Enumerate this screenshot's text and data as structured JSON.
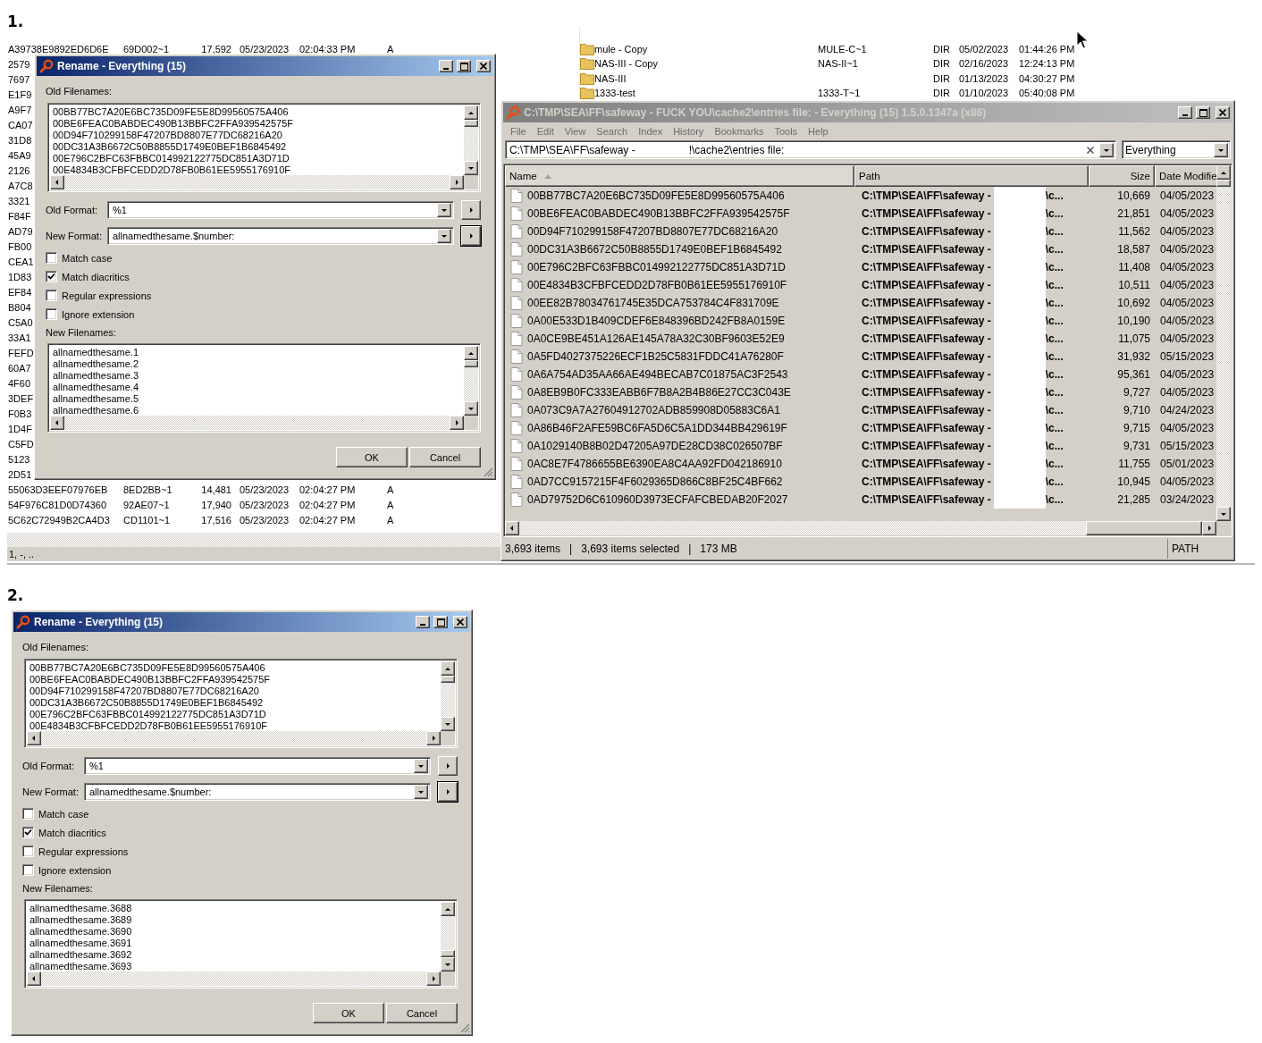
{
  "screenshot_1": {
    "label": "1.",
    "background_list": {
      "rows": [
        {
          "kind": "row",
          "name": "A39738E9892ED6D6E",
          "short_name": "69D002~1",
          "size": "17,592",
          "date": "05/23/2023",
          "time": "02:04:33 PM",
          "attributes": "A"
        },
        {
          "kind": "fragment",
          "name": "2579"
        },
        {
          "kind": "fragment",
          "name": "7697"
        },
        {
          "kind": "fragment",
          "name": "E1F9"
        },
        {
          "kind": "fragment",
          "name": "A9F7"
        },
        {
          "kind": "fragment",
          "name": "CA07"
        },
        {
          "kind": "fragment",
          "name": "31D8"
        },
        {
          "kind": "fragment",
          "name": "45A9"
        },
        {
          "kind": "fragment",
          "name": "2126"
        },
        {
          "kind": "fragment",
          "name": "A7C8"
        },
        {
          "kind": "fragment",
          "name": "3321"
        },
        {
          "kind": "fragment",
          "name": "F84F"
        },
        {
          "kind": "fragment",
          "name": "AD79"
        },
        {
          "kind": "fragment",
          "name": "FB00"
        },
        {
          "kind": "fragment",
          "name": "CEA1"
        },
        {
          "kind": "fragment",
          "name": "1D83"
        },
        {
          "kind": "fragment",
          "name": "EF84"
        },
        {
          "kind": "fragment",
          "name": "B804"
        },
        {
          "kind": "fragment",
          "name": "C5A0"
        },
        {
          "kind": "fragment",
          "name": "33A1"
        },
        {
          "kind": "fragment",
          "name": "FEFD"
        },
        {
          "kind": "fragment",
          "name": "60A7"
        },
        {
          "kind": "fragment",
          "name": "4F60"
        },
        {
          "kind": "fragment",
          "name": "3DEF"
        },
        {
          "kind": "fragment",
          "name": "F0B3"
        },
        {
          "kind": "fragment",
          "name": "1D4F"
        },
        {
          "kind": "fragment",
          "name": "C5FD"
        },
        {
          "kind": "fragment",
          "name": "5123"
        },
        {
          "kind": "fragment",
          "name": "2D51"
        },
        {
          "kind": "row",
          "name": "55063D3EEF07976EB",
          "short_name": "8ED2BB~1",
          "size": "14,481",
          "date": "05/23/2023",
          "time": "02:04:27 PM",
          "attributes": "A"
        },
        {
          "kind": "row",
          "name": "54F976C81D0D74360",
          "short_name": "92AE07~1",
          "size": "17,940",
          "date": "05/23/2023",
          "time": "02:04:27 PM",
          "attributes": "A"
        },
        {
          "kind": "row",
          "name": "5C62C72949B2CA4D3",
          "short_name": "CD1101~1",
          "size": "17,516",
          "date": "05/23/2023",
          "time": "02:04:27 PM",
          "attributes": "A"
        }
      ],
      "status_text": "1, -, .."
    },
    "folder_list": {
      "rows": [
        {
          "name": "mule - Copy",
          "short_name": "MULE-C~1",
          "type": "DIR",
          "date": "05/02/2023",
          "time": "01:44:26 PM"
        },
        {
          "name": "NAS-III - Copy",
          "short_name": "NAS-II~1",
          "type": "DIR",
          "date": "02/16/2023",
          "time": "12:24:13 PM"
        },
        {
          "name": "NAS-III",
          "type": "DIR",
          "date": "01/13/2023",
          "time": "04:30:27 PM"
        },
        {
          "name": "1333-test",
          "short_name": "1333-T~1",
          "type": "DIR",
          "date": "01/10/2023",
          "time": "05:40:08 PM"
        }
      ]
    },
    "rename_dialog": {
      "title": "Rename - Everything (15)",
      "old_filenames_label": "Old Filenames:",
      "old_filenames": [
        "00BB77BC7A20E6BC735D09FE5E8D99560575A406",
        "00BE6FEAC0BABDEC490B13BBFC2FFA939542575F",
        "00D94F710299158F47207BD8807E77DC68216A20",
        "00DC31A3B6672C50B8855D1749E0BEF1B6845492",
        "00E796C2BFC63FBBC014992122775DC851A3D71D",
        "00E4834B3CFBFCEDD2D78FB0B61EE5955176910F"
      ],
      "old_format_label": "Old Format:",
      "old_format": "%1",
      "new_format_label": "New Format:",
      "new_format": "allnamedthesame.$number:",
      "options": [
        {
          "label": "Match case",
          "checked": false
        },
        {
          "label": "Match diacritics",
          "checked": true
        },
        {
          "label": "Regular expressions",
          "checked": false
        },
        {
          "label": "Ignore extension",
          "checked": false
        }
      ],
      "new_filenames_label": "New Filenames:",
      "new_filenames": [
        "allnamedthesame.1",
        "allnamedthesame.2",
        "allnamedthesame.3",
        "allnamedthesame.4",
        "allnamedthesame.5",
        "allnamedthesame.6"
      ],
      "buttons": [
        "OK",
        "Cancel"
      ]
    },
    "everything_window": {
      "title": "C:\\TMP\\SEA\\FF\\safeway - FUCK YOU\\cache2\\entries file: - Everything (15) 1.5.0.1347a (x86)",
      "menu": [
        "File",
        "Edit",
        "View",
        "Search",
        "Index",
        "History",
        "Bookmarks",
        "Tools",
        "Help"
      ],
      "search": {
        "value_start": "C:\\TMP\\SEA\\FF\\safeway -",
        "value_end": "!\\cache2\\entries file:"
      },
      "filter": "Everything",
      "columns": [
        {
          "label": "Name",
          "sorted": true
        },
        {
          "label": "Path",
          "sorted": false
        },
        {
          "label": "Size",
          "sorted": false
        },
        {
          "label": "Date Modifie",
          "sorted": false
        }
      ],
      "rows": [
        {
          "name": "00BB77BC7A20E6BC735D09FE5E8D99560575A406",
          "path_start": "C:\\TMP\\SEA\\FF\\safeway -",
          "path_end": "\\c...",
          "size": "10,669",
          "date": "04/05/2023"
        },
        {
          "name": "00BE6FEAC0BABDEC490B13BBFC2FFA939542575F",
          "path_start": "C:\\TMP\\SEA\\FF\\safeway -",
          "path_end": "\\c...",
          "size": "21,851",
          "date": "04/05/2023"
        },
        {
          "name": "00D94F710299158F47207BD8807E77DC68216A20",
          "path_start": "C:\\TMP\\SEA\\FF\\safeway -",
          "path_end": "\\c...",
          "size": "11,562",
          "date": "04/05/2023"
        },
        {
          "name": "00DC31A3B6672C50B8855D1749E0BEF1B6845492",
          "path_start": "C:\\TMP\\SEA\\FF\\safeway -",
          "path_end": "\\c...",
          "size": "18,587",
          "date": "04/05/2023"
        },
        {
          "name": "00E796C2BFC63FBBC014992122775DC851A3D71D",
          "path_start": "C:\\TMP\\SEA\\FF\\safeway -",
          "path_end": "\\c...",
          "size": "11,408",
          "date": "04/05/2023"
        },
        {
          "name": "00E4834B3CFBFCEDD2D78FB0B61EE5955176910F",
          "path_start": "C:\\TMP\\SEA\\FF\\safeway -",
          "path_end": "\\c...",
          "size": "10,511",
          "date": "04/05/2023"
        },
        {
          "name": "00EE82B78034761745E35DCA753784C4F831709E",
          "path_start": "C:\\TMP\\SEA\\FF\\safeway -",
          "path_end": "\\c...",
          "size": "10,692",
          "date": "04/05/2023"
        },
        {
          "name": "0A00E533D1B409CDEF6E848396BD242FB8A0159E",
          "path_start": "C:\\TMP\\SEA\\FF\\safeway -",
          "path_end": "\\c...",
          "size": "10,190",
          "date": "04/05/2023"
        },
        {
          "name": "0A0CE9BE451A126AE145A78A32C30BF9603E52E9",
          "path_start": "C:\\TMP\\SEA\\FF\\safeway -",
          "path_end": "\\c...",
          "size": "11,075",
          "date": "04/05/2023"
        },
        {
          "name": "0A5FD4027375226ECF1B25C5831FDDC41A76280F",
          "path_start": "C:\\TMP\\SEA\\FF\\safeway -",
          "path_end": "\\c...",
          "size": "31,932",
          "date": "05/15/2023"
        },
        {
          "name": "0A6A754AD35AA66AE494BECAB7C01875AC3F2543",
          "path_start": "C:\\TMP\\SEA\\FF\\safeway -",
          "path_end": "\\c...",
          "size": "95,361",
          "date": "04/05/2023"
        },
        {
          "name": "0A8EB9B0FC333EABB6F7B8A2B4B86E27CC3C043E",
          "path_start": "C:\\TMP\\SEA\\FF\\safeway -",
          "path_end": "\\c...",
          "size": "9,727",
          "date": "04/05/2023"
        },
        {
          "name": "0A073C9A7A27604912702ADB859908D05883C6A1",
          "path_start": "C:\\TMP\\SEA\\FF\\safeway -",
          "path_end": "\\c...",
          "size": "9,710",
          "date": "04/24/2023"
        },
        {
          "name": "0A86B46F2AFE59BC6FA5D6C5A1DD344BB429619F",
          "path_start": "C:\\TMP\\SEA\\FF\\safeway -",
          "path_end": "\\c...",
          "size": "9,715",
          "date": "04/05/2023"
        },
        {
          "name": "0A1029140B8B02D47205A97DE28CD38C026507BF",
          "path_start": "C:\\TMP\\SEA\\FF\\safeway -",
          "path_end": "\\c...",
          "size": "9,731",
          "date": "05/15/2023"
        },
        {
          "name": "0AC8E7F4786655BE6390EA8C4AA92FD042186910",
          "path_start": "C:\\TMP\\SEA\\FF\\safeway -",
          "path_end": "\\c...",
          "size": "11,755",
          "date": "05/01/2023"
        },
        {
          "name": "0AD7CC9157215F4F6029365D866C8BF25C4BF662",
          "path_start": "C:\\TMP\\SEA\\FF\\safeway -",
          "path_end": "\\c...",
          "size": "10,945",
          "date": "04/05/2023"
        },
        {
          "name": "0AD79752D6C610960D3973ECFAFCBEDAB20F2027",
          "path_start": "C:\\TMP\\SEA\\FF\\safeway -",
          "path_end": "\\c...",
          "size": "21,285",
          "date": "03/24/2023"
        }
      ],
      "status": "3,693 items   |   3,693 items selected   |   173 MB",
      "status_right": "PATH"
    }
  },
  "screenshot_2": {
    "label": "2.",
    "rename_dialog": {
      "title": "Rename - Everything (15)",
      "old_filenames_label": "Old Filenames:",
      "old_filenames": [
        "00BB77BC7A20E6BC735D09FE5E8D99560575A406",
        "00BE6FEAC0BABDEC490B13BBFC2FFA939542575F",
        "00D94F710299158F47207BD8807E77DC68216A20",
        "00DC31A3B6672C50B8855D1749E0BEF1B6845492",
        "00E796C2BFC63FBBC014992122775DC851A3D71D",
        "00E4834B3CFBFCEDD2D78FB0B61EE5955176910F"
      ],
      "old_format_label": "Old Format:",
      "old_format": "%1",
      "new_format_label": "New Format:",
      "new_format": "allnamedthesame.$number:",
      "options": [
        {
          "label": "Match case",
          "checked": false
        },
        {
          "label": "Match diacritics",
          "checked": true
        },
        {
          "label": "Regular expressions",
          "checked": false
        },
        {
          "label": "Ignore extension",
          "checked": false
        }
      ],
      "new_filenames_label": "New Filenames:",
      "new_filenames": [
        "allnamedthesame.3688",
        "allnamedthesame.3689",
        "allnamedthesame.3690",
        "allnamedthesame.3691",
        "allnamedthesame.3692",
        "allnamedthesame.3693"
      ],
      "buttons": [
        "OK",
        "Cancel"
      ]
    }
  }
}
